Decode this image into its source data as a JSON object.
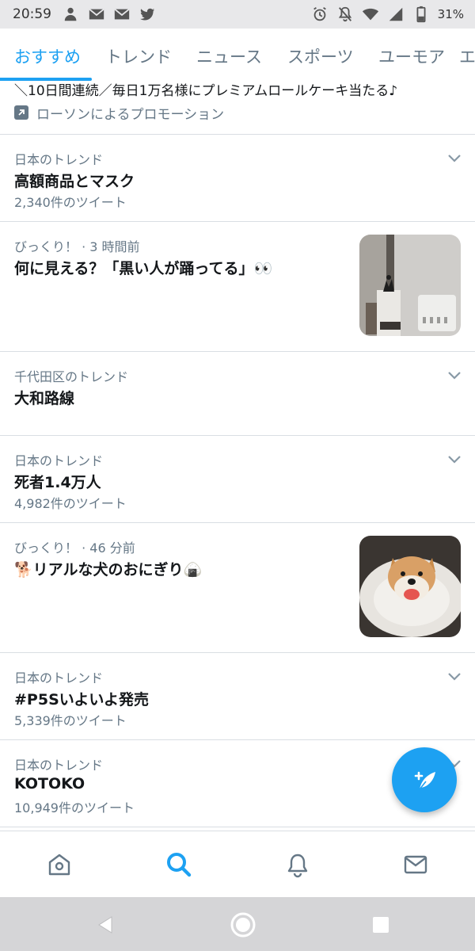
{
  "status_bar": {
    "time": "20:59",
    "battery_percent": "31%",
    "left_icons": [
      "account-icon",
      "mail-icon",
      "mail-icon",
      "twitter-icon"
    ],
    "right_icons": [
      "alarm-icon",
      "notifications-off-icon",
      "wifi-icon",
      "signal-icon",
      "battery-icon"
    ]
  },
  "tabs": [
    {
      "label": "おすすめ",
      "active": true
    },
    {
      "label": "トレンド",
      "active": false
    },
    {
      "label": "ニュース",
      "active": false
    },
    {
      "label": "スポーツ",
      "active": false
    },
    {
      "label": "ユーモア",
      "active": false
    },
    {
      "label": "エ",
      "active": false
    }
  ],
  "promo": {
    "text": "＼10日間連続／毎日1万名様にプレミアムロールケーキ当たる♪",
    "sponsor": "ローソンによるプロモーション"
  },
  "items": [
    {
      "meta": "日本のトレンド",
      "title": "高額商品とマスク",
      "count": "2,340件のツイート"
    },
    {
      "meta": "びっくり！ · 3 時間前",
      "title": "何に見える？「黒い人が踊ってる」👀"
    },
    {
      "meta": "千代田区のトレンド",
      "title": "大和路線"
    },
    {
      "meta": "日本のトレンド",
      "title": "死者1.4万人",
      "count": "4,982件のツイート"
    },
    {
      "meta": "びっくり！ · 46 分前",
      "title": "🐕リアルな犬のおにぎり🍙"
    },
    {
      "meta": "日本のトレンド",
      "title": "#P5Sいよいよ発売",
      "count": "5,339件のツイート"
    },
    {
      "meta": "日本のトレンド",
      "title": "KOTOKO",
      "count": "10,949件のツイート"
    }
  ],
  "colors": {
    "accent": "#1da1f2",
    "text_primary": "#14171a",
    "text_secondary": "#657786",
    "divider": "#d9dee3"
  },
  "bottom_nav": [
    "home-icon",
    "search-icon",
    "notifications-icon",
    "messages-icon"
  ],
  "bottom_nav_active": "search-icon"
}
